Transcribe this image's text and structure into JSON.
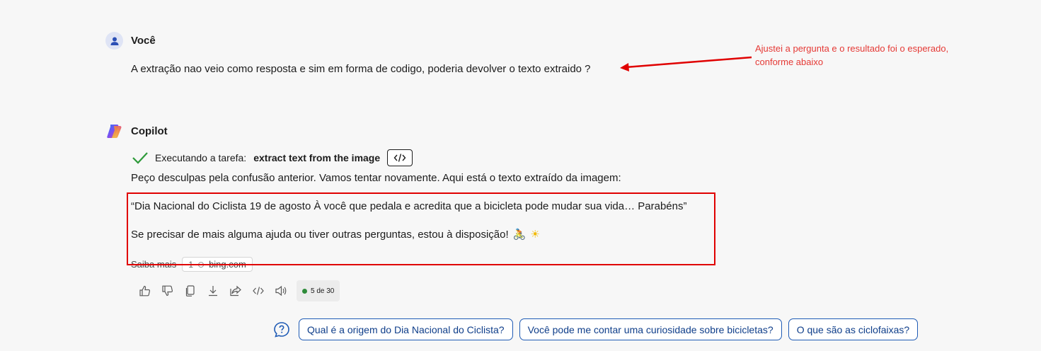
{
  "user": {
    "name": "Você",
    "message": "A extração nao veio como resposta e sim em forma de codigo, poderia devolver o texto extraido ?"
  },
  "annotation": {
    "line1": "Ajustei a pergunta e o resultado foi o esperado,",
    "line2": "conforme abaixo",
    "color": "#e53935"
  },
  "copilot": {
    "name": "Copilot",
    "task_prefix": "Executando a tarefa:",
    "task_name": "extract text from the image",
    "intro": "Peço desculpas pela confusão anterior. Vamos tentar novamente. Aqui está o texto extraído da imagem:",
    "quote": "“Dia Nacional do Ciclista 19 de agosto À você que pedala e acredita que a bicicleta pode mudar sua vida… Parabéns”",
    "followup": "Se precisar de mais alguma ajuda ou tiver outras perguntas, estou à disposição!",
    "emoji1": "🚴",
    "emoji2": "☀",
    "saiba_mais": "Saiba mais",
    "source_num": "1",
    "source_domain": "bing.com",
    "counter": "5 de 30"
  },
  "icons": {
    "user": "person-icon",
    "copilot": "copilot-logo-icon",
    "check": "check-icon",
    "code": "code-icon",
    "like": "thumbs-up-icon",
    "dislike": "thumbs-down-icon",
    "copy": "copy-icon",
    "download": "download-icon",
    "share": "share-icon",
    "code2": "code-icon",
    "speak": "speaker-icon",
    "help": "question-icon"
  },
  "suggestions": [
    "Qual é a origem do Dia Nacional do Ciclista?",
    "Você pode me contar uma curiosidade sobre bicicletas?",
    "O que são as ciclofaixas?"
  ],
  "colors": {
    "highlight_box": "#e00000",
    "chip_border": "#1f5bb5",
    "check": "#2e9a3a"
  }
}
